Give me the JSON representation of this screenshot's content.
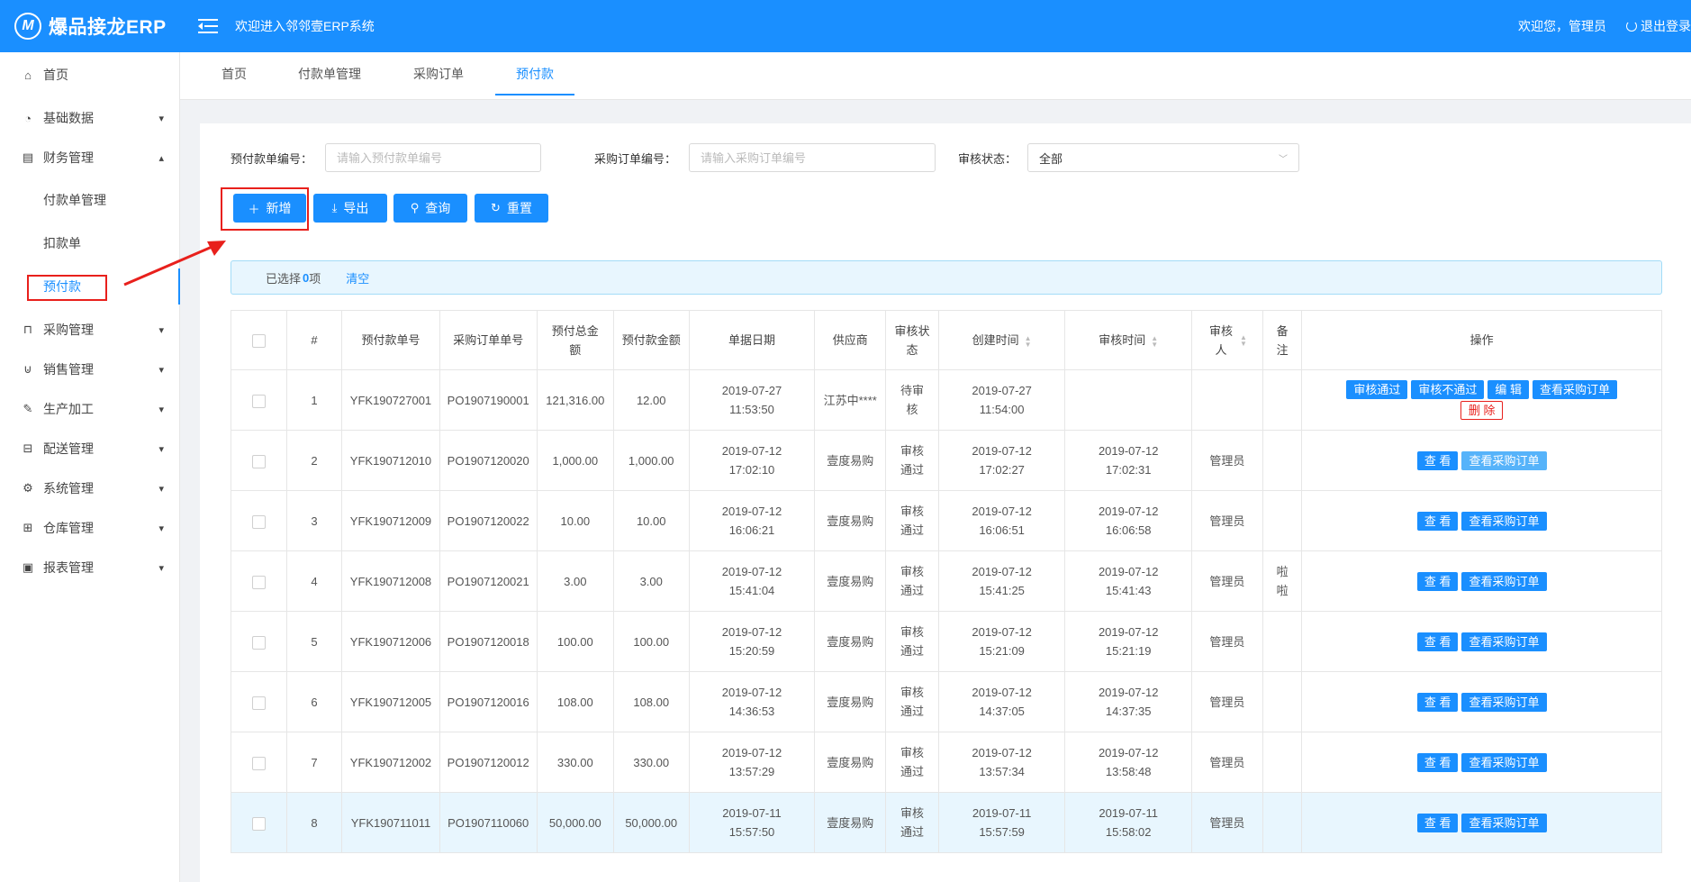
{
  "header": {
    "logo_mark": "M",
    "app_name": "爆品接龙ERP",
    "welcome": "欢迎进入邻邻壹ERP系统",
    "user_greeting": "欢迎您，管理员",
    "logout": "退出登录",
    "color": "#1a8fff"
  },
  "sidebar": {
    "items": [
      {
        "label": "首页",
        "icon": "home-icon"
      },
      {
        "label": "基础数据",
        "icon": "pie-chart-icon"
      },
      {
        "label": "财务管理",
        "icon": "ledger-icon"
      },
      {
        "label": "采购管理",
        "icon": "shopping-bag-icon"
      },
      {
        "label": "销售管理",
        "icon": "cart-icon"
      },
      {
        "label": "生产加工",
        "icon": "wrench-icon"
      },
      {
        "label": "配送管理",
        "icon": "truck-icon"
      },
      {
        "label": "系统管理",
        "icon": "gear-icon"
      },
      {
        "label": "仓库管理",
        "icon": "warehouse-icon"
      },
      {
        "label": "报表管理",
        "icon": "report-icon"
      }
    ],
    "sub_items": [
      {
        "label": "付款单管理"
      },
      {
        "label": "扣款单"
      },
      {
        "label": "预付款"
      }
    ]
  },
  "tabs": [
    {
      "label": "首页"
    },
    {
      "label": "付款单管理"
    },
    {
      "label": "采购订单"
    },
    {
      "label": "预付款"
    }
  ],
  "filters": {
    "prepay_no_label": "预付款单编号：",
    "prepay_no_placeholder": "请输入预付款单编号",
    "po_no_label": "采购订单编号：",
    "po_no_placeholder": "请输入采购订单编号",
    "status_label": "审核状态：",
    "status_value": "全部"
  },
  "actions": {
    "add": "新增",
    "export": "导出",
    "query": "查询",
    "reset": "重置"
  },
  "selection": {
    "prefix": "已选择",
    "count": "0",
    "suffix": "项",
    "clear": "清空"
  },
  "table": {
    "headers": {
      "index": "#",
      "prepay_no": "预付款单号",
      "po_no": "采购订单单号",
      "total": "预付总金额",
      "amount": "预付款金额",
      "date": "单据日期",
      "supplier": "供应商",
      "status": "审核状态",
      "created": "创建时间",
      "audited": "审核时间",
      "auditor": "审核人",
      "remark": "备注",
      "ops": "操作"
    },
    "rows": [
      {
        "index": "1",
        "prepay_no": "YFK190727001",
        "po_no": "PO1907190001",
        "total": "121,316.00",
        "amount": "12.00",
        "date": "2019-07-27 11:53:50",
        "supplier": "江苏中****",
        "status": "待审核",
        "created": "2019-07-27 11:54:00",
        "audited": "",
        "auditor": "",
        "remark": ""
      },
      {
        "index": "2",
        "prepay_no": "YFK190712010",
        "po_no": "PO1907120020",
        "total": "1,000.00",
        "amount": "1,000.00",
        "date": "2019-07-12 17:02:10",
        "supplier": "壹度易购",
        "status": "审核通过",
        "created": "2019-07-12 17:02:27",
        "audited": "2019-07-12 17:02:31",
        "auditor": "管理员",
        "remark": ""
      },
      {
        "index": "3",
        "prepay_no": "YFK190712009",
        "po_no": "PO1907120022",
        "total": "10.00",
        "amount": "10.00",
        "date": "2019-07-12 16:06:21",
        "supplier": "壹度易购",
        "status": "审核通过",
        "created": "2019-07-12 16:06:51",
        "audited": "2019-07-12 16:06:58",
        "auditor": "管理员",
        "remark": ""
      },
      {
        "index": "4",
        "prepay_no": "YFK190712008",
        "po_no": "PO1907120021",
        "total": "3.00",
        "amount": "3.00",
        "date": "2019-07-12 15:41:04",
        "supplier": "壹度易购",
        "status": "审核通过",
        "created": "2019-07-12 15:41:25",
        "audited": "2019-07-12 15:41:43",
        "auditor": "管理员",
        "remark": "啦啦"
      },
      {
        "index": "5",
        "prepay_no": "YFK190712006",
        "po_no": "PO1907120018",
        "total": "100.00",
        "amount": "100.00",
        "date": "2019-07-12 15:20:59",
        "supplier": "壹度易购",
        "status": "审核通过",
        "created": "2019-07-12 15:21:09",
        "audited": "2019-07-12 15:21:19",
        "auditor": "管理员",
        "remark": ""
      },
      {
        "index": "6",
        "prepay_no": "YFK190712005",
        "po_no": "PO1907120016",
        "total": "108.00",
        "amount": "108.00",
        "date": "2019-07-12 14:36:53",
        "supplier": "壹度易购",
        "status": "审核通过",
        "created": "2019-07-12 14:37:05",
        "audited": "2019-07-12 14:37:35",
        "auditor": "管理员",
        "remark": ""
      },
      {
        "index": "7",
        "prepay_no": "YFK190712002",
        "po_no": "PO1907120012",
        "total": "330.00",
        "amount": "330.00",
        "date": "2019-07-12 13:57:29",
        "supplier": "壹度易购",
        "status": "审核通过",
        "created": "2019-07-12 13:57:34",
        "audited": "2019-07-12 13:58:48",
        "auditor": "管理员",
        "remark": ""
      },
      {
        "index": "8",
        "prepay_no": "YFK190711011",
        "po_no": "PO1907110060",
        "total": "50,000.00",
        "amount": "50,000.00",
        "date": "2019-07-11 15:57:50",
        "supplier": "壹度易购",
        "status": "审核通过",
        "created": "2019-07-11 15:57:59",
        "audited": "2019-07-11 15:58:02",
        "auditor": "管理员",
        "remark": ""
      }
    ],
    "pending_ops": {
      "approve": "审核通过",
      "reject": "审核不通过",
      "edit": "编 辑",
      "view_po": "查看采购订单",
      "delete": "删 除"
    },
    "done_ops": {
      "view": "查 看",
      "view_po": "查看采购订单"
    }
  },
  "colors": {
    "accent": "#1a8fff",
    "annotation": "#e8201c"
  }
}
